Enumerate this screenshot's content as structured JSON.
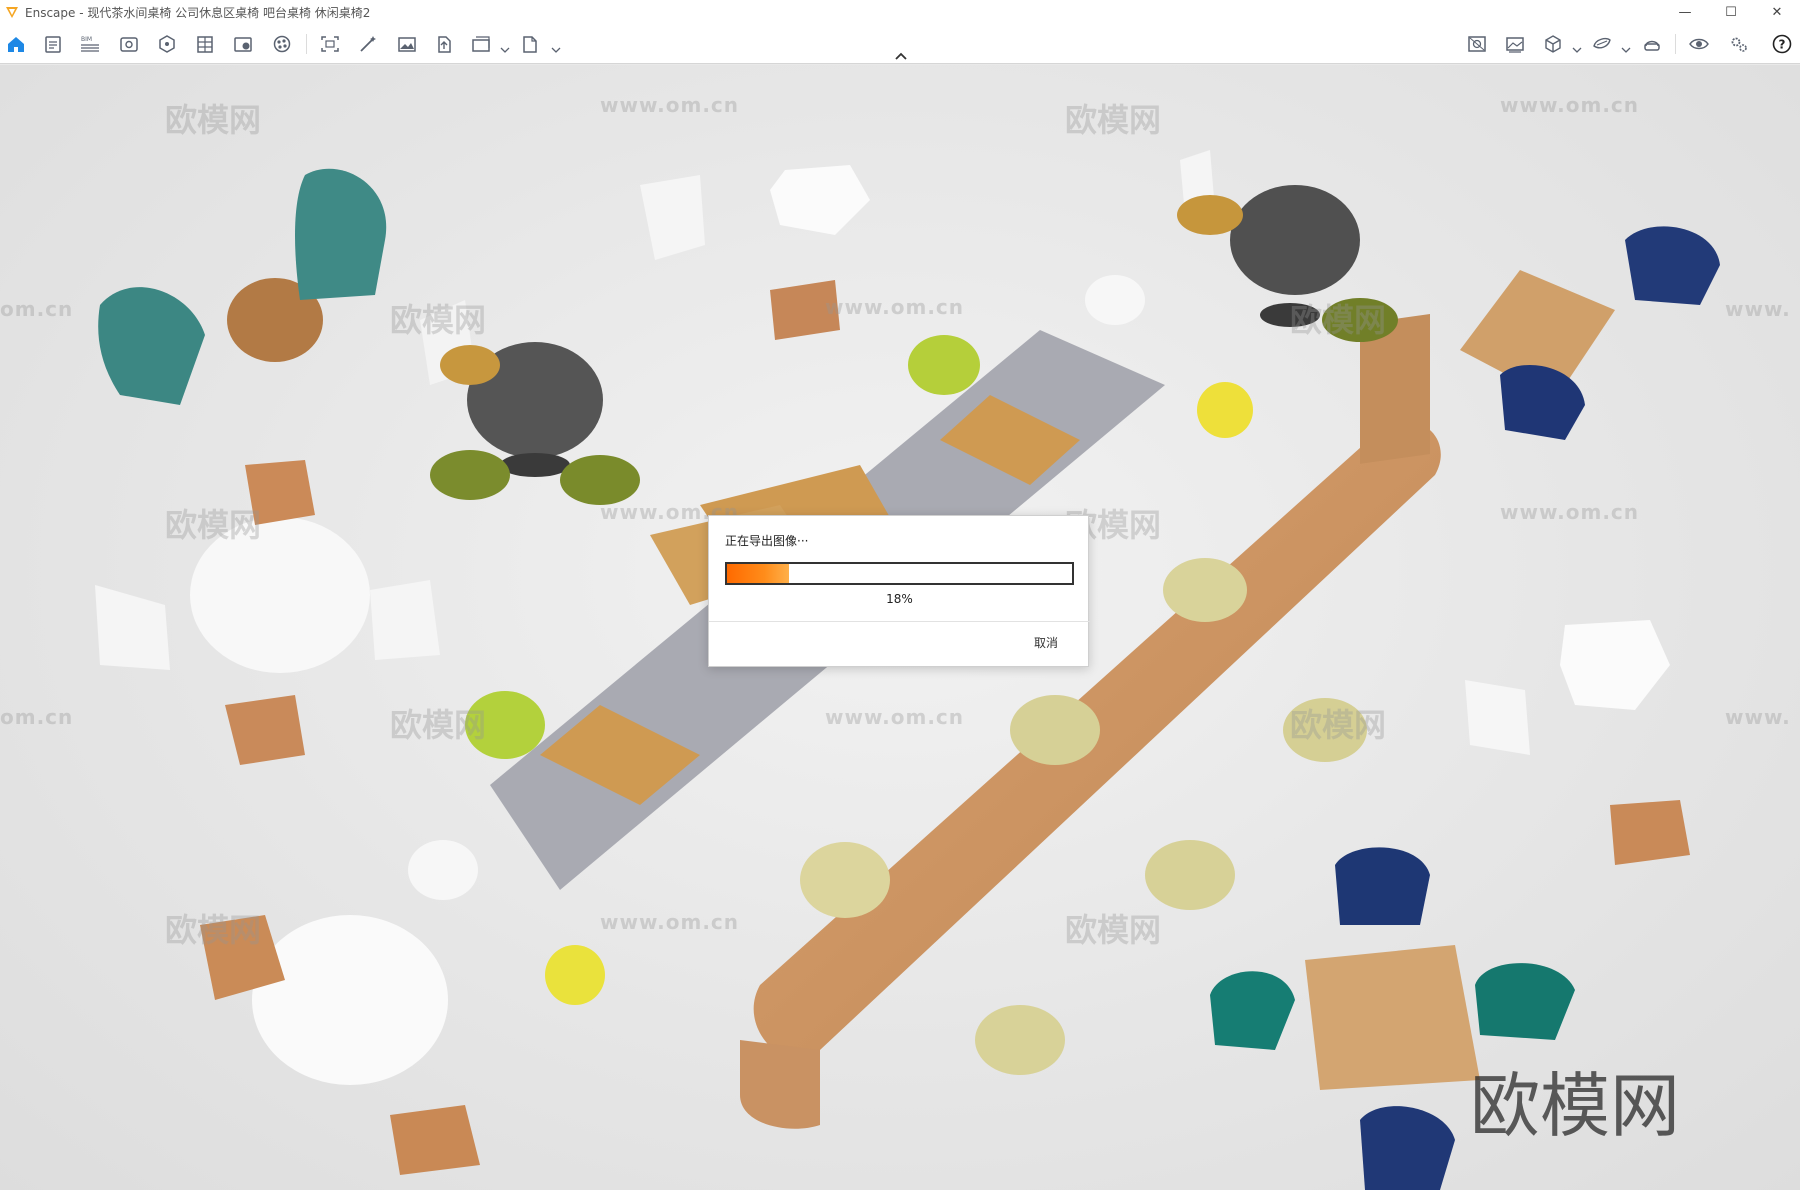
{
  "window": {
    "title": "Enscape - 现代茶水间桌椅 公司休息区桌椅 吧台桌椅 休闲桌椅2",
    "controls": {
      "minimize": "—",
      "maximize": "☐",
      "close": "✕"
    }
  },
  "toolbar": {
    "left_icons": [
      "home-icon",
      "notes-icon",
      "bim-icon",
      "views-icon",
      "sites-icon",
      "layers-icon",
      "asset-library-icon",
      "material-editor-icon",
      "capture-icon",
      "magic-wand-icon",
      "image-editor-icon",
      "upload-icon",
      "batch-render-icon",
      "export-icon"
    ],
    "bim_label": "BIM",
    "right_icons": [
      "panorama-icon",
      "gallery-icon",
      "cube-icon",
      "vr-headset-icon",
      "vr-icon",
      "eye-icon",
      "settings-icon",
      "help-icon"
    ],
    "help_label": "?"
  },
  "watermarks": {
    "brand": "欧模网",
    "url": "www.om.cn",
    "url_fragment": "om.cn",
    "url_cropped": "www."
  },
  "dialog": {
    "title": "正在导出图像···",
    "progress": 0.18,
    "progress_label": "18%",
    "cancel_label": "取消"
  },
  "colors": {
    "accent_orange": "#ff7a00",
    "enscape_logo": "#f5a623",
    "toolbar_icon": "#5a6270",
    "home_icon": "#1e88e5"
  }
}
